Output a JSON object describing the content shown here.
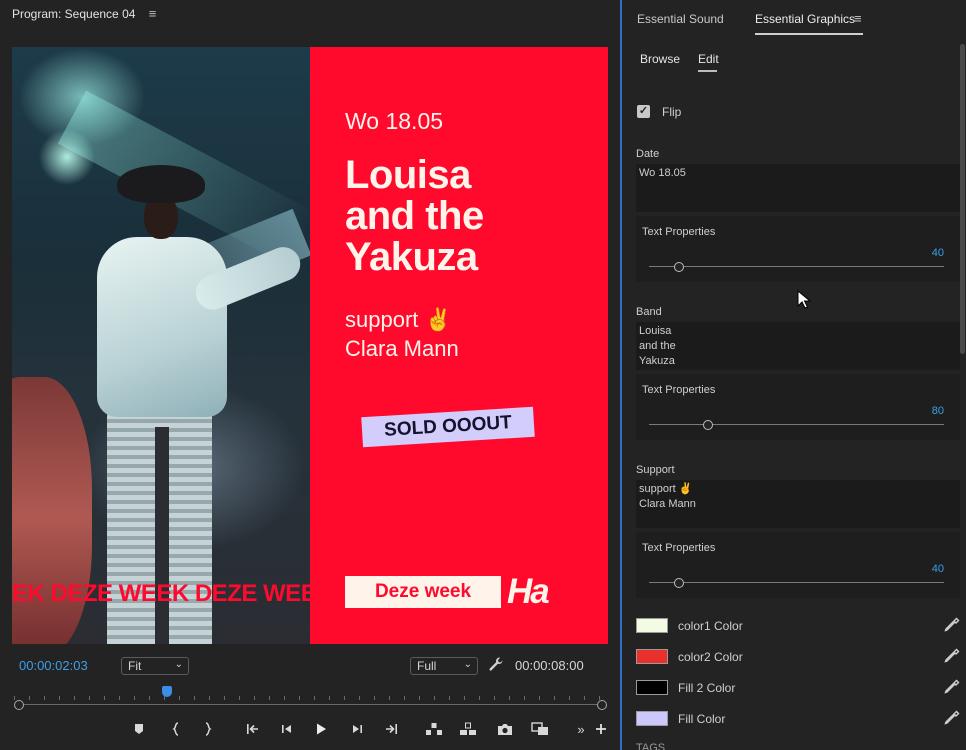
{
  "program": {
    "title": "Program: Sequence 04",
    "menu_glyph": "≡",
    "video": {
      "ticker_text": "EK  DEZE WEEK  DEZE WEEK",
      "date": "Wo 18.05",
      "band": "Louisa\nand the\nYakuza",
      "support": "support ✌\nClara Mann",
      "sold_out": "SOLD OOOUT",
      "week_button": "Deze week",
      "logo": "Ha",
      "colors": {
        "red": "#ff0a2c",
        "cream": "#fff3ea",
        "lavender": "#d3cdfc"
      }
    },
    "controls": {
      "current_time": "00:00:02:03",
      "zoom": "Fit",
      "quality": "Full",
      "duration": "00:00:08:00",
      "playhead_fraction": 0.26
    }
  },
  "panel": {
    "tabs": [
      "Essential Sound",
      "Essential Graphics"
    ],
    "menu_glyph": "≡",
    "subtabs": [
      "Browse",
      "Edit"
    ],
    "flip": {
      "label": "Flip",
      "checked": true
    },
    "fields": [
      {
        "label": "Date",
        "value": "Wo 18.05",
        "props_title": "Text Properties",
        "size": "40",
        "slider_fraction": 0.1
      },
      {
        "label": "Band",
        "value": "Louisa\nand the\nYakuza",
        "props_title": "Text Properties",
        "size": "80",
        "slider_fraction": 0.2
      },
      {
        "label": "Support",
        "value": "support ✌\nClara Mann",
        "props_title": "Text Properties",
        "size": "40",
        "slider_fraction": 0.1
      }
    ],
    "colors": [
      {
        "label": "color1 Color",
        "hex": "#f3fbe2"
      },
      {
        "label": "color2 Color",
        "hex": "#e8302c"
      },
      {
        "label": "Fill 2 Color",
        "hex": "#000000"
      },
      {
        "label": "Fill Color",
        "hex": "#cdc8fb"
      }
    ],
    "tags_label": "TAGS",
    "accent": "#3c9fe8"
  }
}
